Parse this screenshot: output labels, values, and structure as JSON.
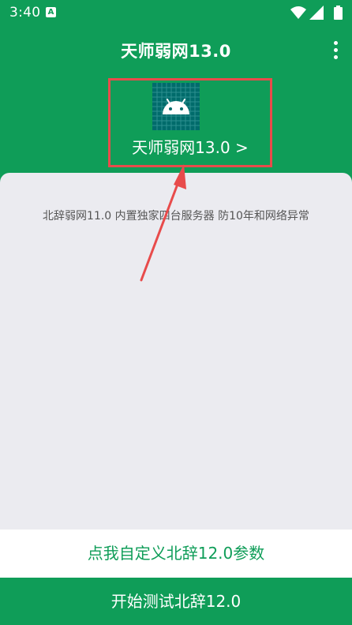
{
  "status_bar": {
    "time": "3:40",
    "left_icon": "a-letter-icon",
    "right_icons": [
      "wifi-icon",
      "signal-icon",
      "battery-icon"
    ]
  },
  "app_bar": {
    "title": "天师弱网13.0",
    "menu_icon": "more-vertical-icon"
  },
  "header": {
    "logo_icon": "android-icon",
    "label": "天师弱网13.0 >"
  },
  "content": {
    "notice": "北辞弱网11.0 内置独家四台服务器 防10年和网络异常"
  },
  "buttons": {
    "custom_label": "点我自定义北辞12.0参数",
    "start_label": "开始测试北辞12.0"
  },
  "colors": {
    "brand_green": "#0f9d58",
    "annotation_red": "#e84b4b",
    "card_background": "#ebebf0",
    "logo_teal": "#006b6b"
  }
}
